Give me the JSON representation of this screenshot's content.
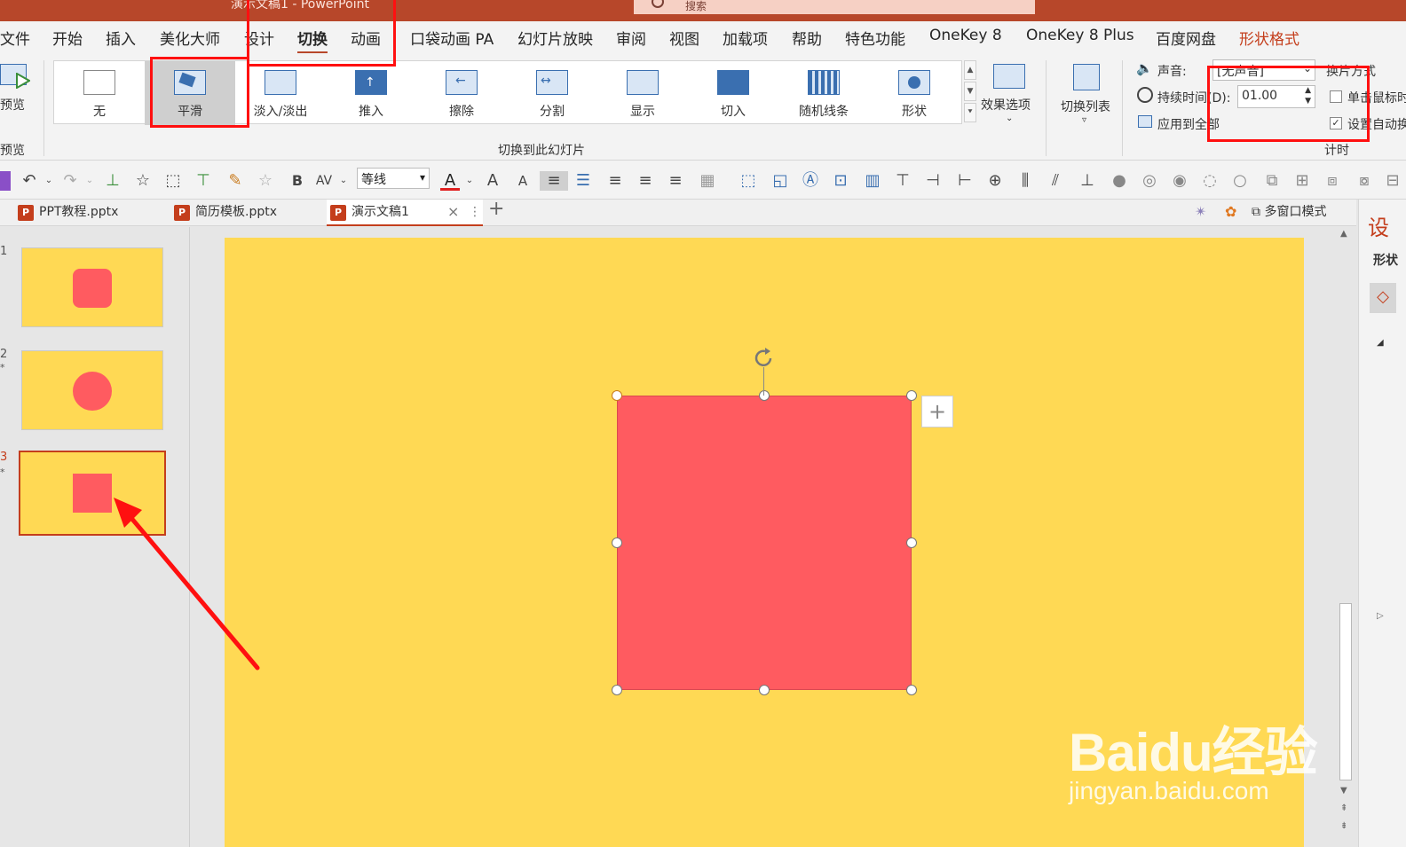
{
  "window": {
    "title": "演示文稿1 - PowerPoint"
  },
  "search": {
    "placeholder": "搜索"
  },
  "tabs": [
    {
      "label": "文件"
    },
    {
      "label": "开始"
    },
    {
      "label": "插入"
    },
    {
      "label": "美化大师"
    },
    {
      "label": "设计"
    },
    {
      "label": "切换",
      "active": true
    },
    {
      "label": "动画"
    },
    {
      "label": "口袋动画 PA"
    },
    {
      "label": "幻灯片放映"
    },
    {
      "label": "审阅"
    },
    {
      "label": "视图"
    },
    {
      "label": "加载项"
    },
    {
      "label": "帮助"
    },
    {
      "label": "特色功能"
    },
    {
      "label": "OneKey 8"
    },
    {
      "label": "OneKey 8 Plus"
    },
    {
      "label": "百度网盘"
    },
    {
      "label": "形状格式"
    }
  ],
  "ribbon": {
    "preview": {
      "button": "预览",
      "group": "预览"
    },
    "transitions": {
      "group": "切换到此幻灯片",
      "items": [
        {
          "label": "无"
        },
        {
          "label": "平滑",
          "selected": true
        },
        {
          "label": "淡入/淡出"
        },
        {
          "label": "推入"
        },
        {
          "label": "擦除"
        },
        {
          "label": "分割"
        },
        {
          "label": "显示"
        },
        {
          "label": "切入"
        },
        {
          "label": "随机线条"
        },
        {
          "label": "形状"
        }
      ],
      "effect_options": "效果选项",
      "transition_list": "切换列表"
    },
    "timing": {
      "group": "计时",
      "sound_label": "声音:",
      "sound_value": "[无声音]",
      "duration_label": "持续时间(D):",
      "duration_value": "01.00",
      "apply_all": "应用到全部",
      "advance_label": "换片方式",
      "on_click": "单击鼠标时",
      "on_click_checked": false,
      "after": "设置自动换片时间",
      "after_checked": true
    }
  },
  "toolbar": {
    "font": "等线",
    "bold": "B"
  },
  "doc_tabs": [
    {
      "label": "PPT教程.pptx"
    },
    {
      "label": "简历模板.pptx"
    },
    {
      "label": "演示文稿1",
      "active": true
    }
  ],
  "doc_tabs_right": {
    "multi_window": "多窗口模式"
  },
  "slides": [
    {
      "number": "1",
      "shape": "rounded-square"
    },
    {
      "number": "2",
      "star": "*",
      "shape": "circle"
    },
    {
      "number": "3",
      "star": "*",
      "shape": "square",
      "selected": true
    }
  ],
  "right_pane": {
    "title": "设",
    "subtitle": "形状"
  },
  "watermark": {
    "brand": "Baidu经验",
    "url": "jingyan.baidu.com"
  },
  "colors": {
    "accent": "#b7472a",
    "slide_bg": "#ffd954",
    "shape_fill": "#ff5b60",
    "annotation": "#ff1010"
  }
}
